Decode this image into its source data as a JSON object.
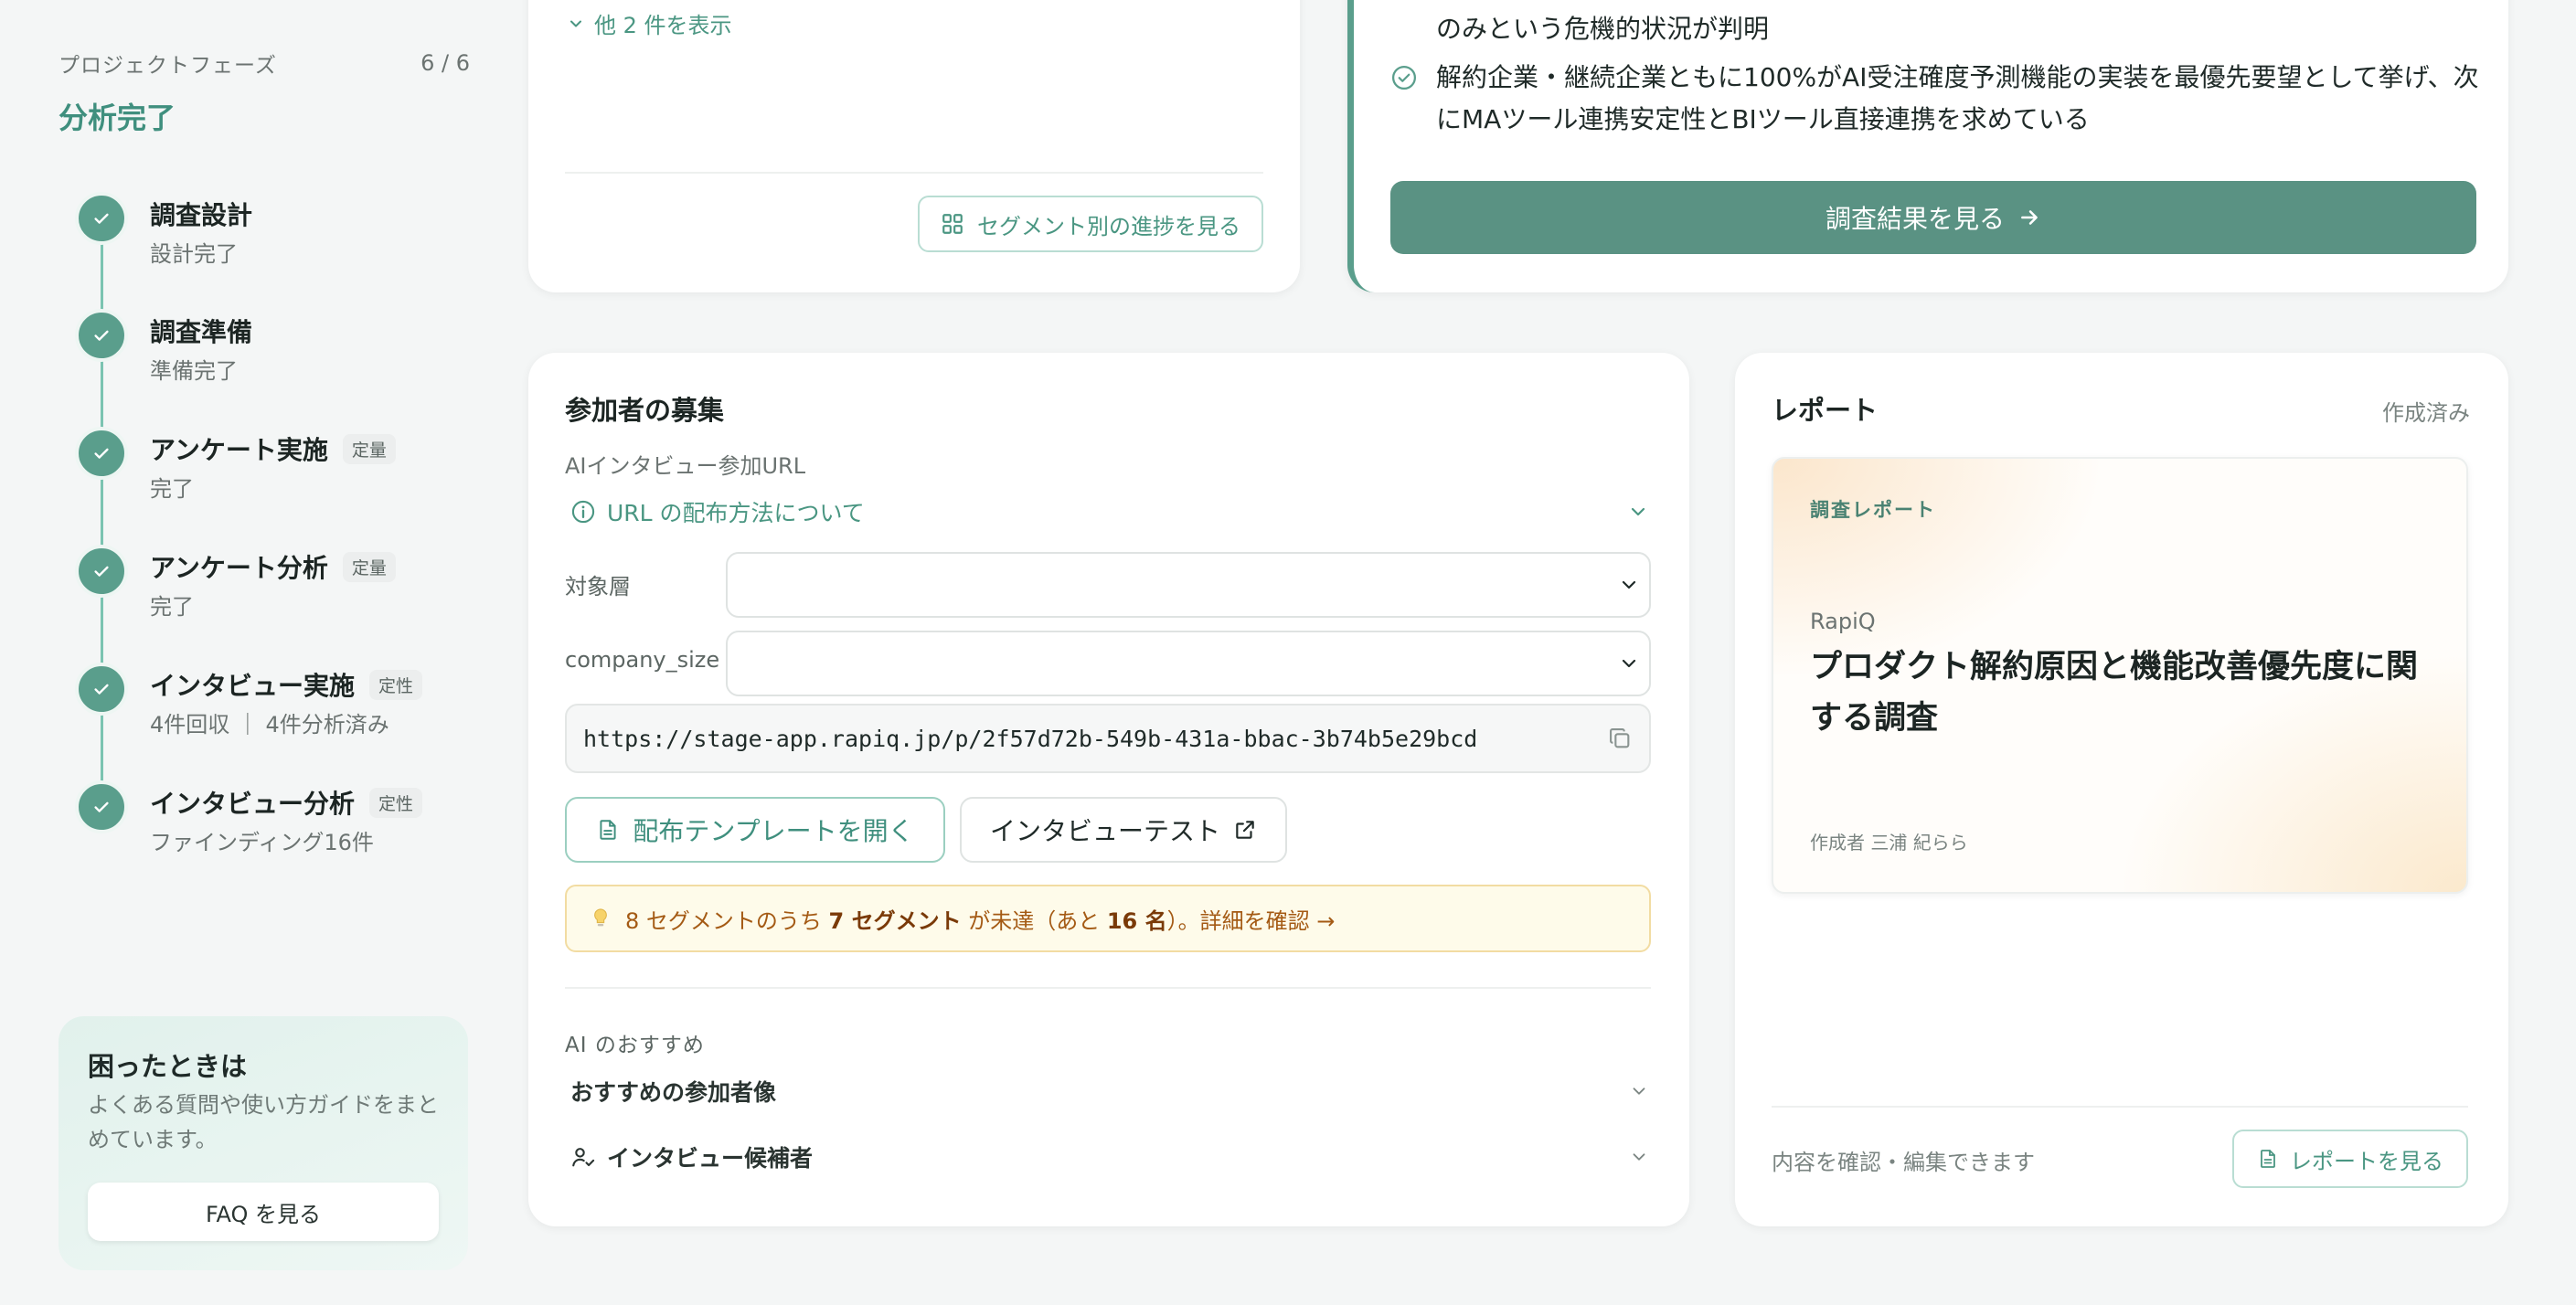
{
  "sidebar": {
    "phase_caption": "プロジェクトフェーズ",
    "phase_count": "6 / 6",
    "phase_title": "分析完了",
    "steps": [
      {
        "title": "調査設計",
        "badge": "",
        "sub": "設計完了"
      },
      {
        "title": "調査準備",
        "badge": "",
        "sub": "準備完了"
      },
      {
        "title": "アンケート実施",
        "badge": "定量",
        "sub": "完了"
      },
      {
        "title": "アンケート分析",
        "badge": "定量",
        "sub": "完了"
      },
      {
        "title": "インタビュー実施",
        "badge": "定性",
        "sub": "4件回収 ｜ 4件分析済み"
      },
      {
        "title": "インタビュー分析",
        "badge": "定性",
        "sub": "ファインディング16件"
      }
    ],
    "help": {
      "title": "困ったときは",
      "text": "よくある質問や使い方ガイドをまとめています。",
      "button": "FAQ を見る"
    }
  },
  "progress_card": {
    "show_more": "他 2 件を表示",
    "segment_button": "セグメント別の進捗を見る"
  },
  "findings_card": {
    "finding_1_tail": "のみという危機的状況が判明",
    "finding_2": "解約企業・継続企業ともに100%がAI受注確度予測機能の実装を最優先要望として挙げ、次にMAツール連携安定性とBIツール直接連携を求めている",
    "results_button": "調査結果を見る"
  },
  "recruit_card": {
    "title": "参加者の募集",
    "url_label": "AIインタビュー参加URL",
    "distribution_toggle": "URL の配布方法について",
    "field_segment_label": "対象層",
    "field_segment_value": "",
    "field_company_label": "company_size",
    "field_company_value": "",
    "url": "https://stage-app.rapiq.jp/p/2f57d72b-549b-431a-bbac-3b74b5e29bcd",
    "template_button": "配布テンプレートを開く",
    "test_button": "インタビューテスト",
    "warning": {
      "prefix": "8 セグメントのうち ",
      "count": "7 セグメント",
      "middle": " が未達（あと ",
      "remaining": "16 名",
      "suffix": "）。詳細を確認 →"
    },
    "ai_label": "AI のおすすめ",
    "ai_rows": [
      {
        "label": "おすすめの参加者像"
      },
      {
        "label": "インタビュー候補者"
      }
    ]
  },
  "report_card": {
    "title": "レポート",
    "status": "作成済み",
    "cover_tag": "調査レポート",
    "cover_brand": "RapiQ",
    "cover_title": "プロダクト解約原因と機能改善優先度に関する調査",
    "cover_author": "作成者 三浦 紀らら",
    "note": "内容を確認・編集できます",
    "button": "レポートを見る"
  },
  "colors": {
    "accent": "#5a9e8c",
    "primary_button": "#5a9283",
    "warning_bg": "#fefbea",
    "warning_text": "#a45a14"
  }
}
